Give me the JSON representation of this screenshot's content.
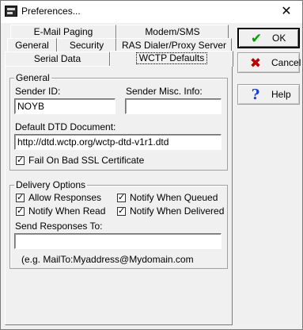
{
  "window": {
    "title": "Preferences..."
  },
  "tabs": {
    "row1": [
      {
        "label": "E-Mail Paging"
      },
      {
        "label": "Modem/SMS"
      }
    ],
    "row2": [
      {
        "label": "General"
      },
      {
        "label": "Security"
      },
      {
        "label": "RAS Dialer/Proxy Server"
      }
    ],
    "row3": [
      {
        "label": "Serial Data"
      },
      {
        "label": "WCTP Defaults"
      }
    ]
  },
  "general_group": {
    "legend": "General",
    "sender_id_label": "Sender ID:",
    "sender_id_value": "NOYB",
    "sender_misc_label": "Sender Misc. Info:",
    "sender_misc_value": "",
    "default_dtd_label": "Default DTD Document:",
    "default_dtd_value": "http://dtd.wctp.org/wctp-dtd-v1r1.dtd",
    "fail_ssl_label": "Fail On Bad SSL Certificate",
    "fail_ssl_checked": true
  },
  "delivery_group": {
    "legend": "Delivery Options",
    "allow_responses_label": "Allow Responses",
    "notify_queued_label": "Notify When Queued",
    "notify_read_label": "Notify When Read",
    "notify_delivered_label": "Notify When Delivered",
    "send_responses_label": "Send Responses To:",
    "send_responses_value": "",
    "hint": "(e.g. MailTo:Myaddress@Mydomain.com"
  },
  "buttons": {
    "ok": "OK",
    "cancel": "Cancel",
    "help": "Help"
  },
  "colors": {
    "ok_icon": "#00a000",
    "cancel_icon": "#c00000",
    "help_icon": "#1a3fc4"
  }
}
